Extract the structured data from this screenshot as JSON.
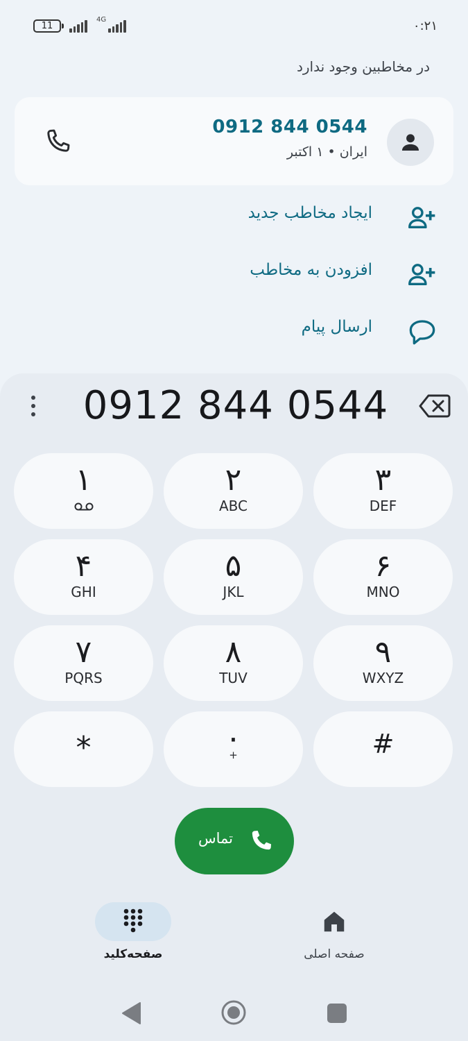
{
  "status_bar": {
    "battery_level": "11",
    "network_type": "4G",
    "time": "۰:۲۱"
  },
  "header": {
    "no_contact_text": "در مخاطبین وجود ندارد"
  },
  "contact_card": {
    "number": "0912 844 0544",
    "subtitle": "ایران • ۱ اکتبر",
    "icons": [
      "person-icon",
      "phone-icon"
    ]
  },
  "actions": [
    {
      "label": "ایجاد مخاطب جدید",
      "icon": "add-person-icon"
    },
    {
      "label": "افزودن به مخاطب",
      "icon": "add-person-icon"
    },
    {
      "label": "ارسال پیام",
      "icon": "message-icon"
    }
  ],
  "dialer": {
    "entered_number": "0912 844 0544",
    "keys": [
      {
        "digit": "۱",
        "letters": ""
      },
      {
        "digit": "۲",
        "letters": "ABC"
      },
      {
        "digit": "۳",
        "letters": "DEF"
      },
      {
        "digit": "۴",
        "letters": "GHI"
      },
      {
        "digit": "۵",
        "letters": "JKL"
      },
      {
        "digit": "۶",
        "letters": "MNO"
      },
      {
        "digit": "۷",
        "letters": "PQRS"
      },
      {
        "digit": "۸",
        "letters": "TUV"
      },
      {
        "digit": "۹",
        "letters": "WXYZ"
      },
      {
        "digit": "*",
        "letters": ""
      },
      {
        "digit": "۰",
        "letters": "+"
      },
      {
        "digit": "#",
        "letters": ""
      }
    ],
    "call_label": "تماس"
  },
  "bottom_nav": {
    "keypad_label": "صفحه‌کلید",
    "home_label": "صفحه اصلی"
  },
  "colors": {
    "accent_teal": "#0e6a82",
    "call_green": "#1e8e3e",
    "background": "#eef3f8",
    "key_background": "#f7f9fb"
  }
}
